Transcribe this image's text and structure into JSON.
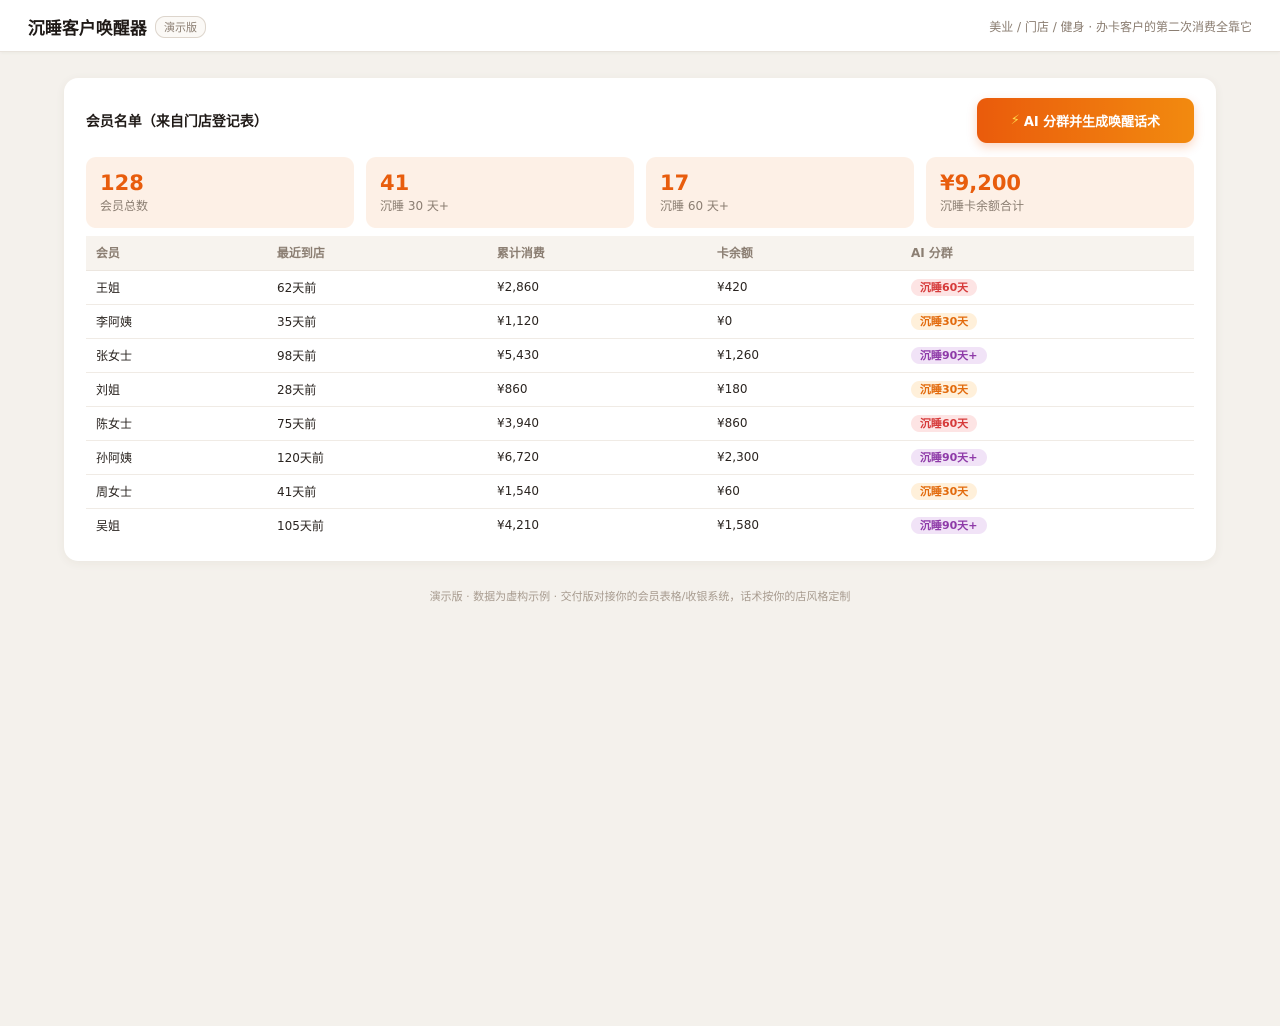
{
  "header": {
    "title": "沉睡客户唤醒器",
    "tag": "演示版",
    "subtitle": "美业 / 门店 / 健身 · 办卡客户的第二次消费全靠它"
  },
  "card": {
    "title": "会员名单（来自门店登记表）",
    "action_icon": "⚡",
    "action_label": "AI 分群并生成唤醒话术"
  },
  "stats": [
    {
      "value": "128",
      "label": "会员总数"
    },
    {
      "value": "41",
      "label": "沉睡 30 天+"
    },
    {
      "value": "17",
      "label": "沉睡 60 天+"
    },
    {
      "value": "¥9,200",
      "label": "沉睡卡余额合计"
    }
  ],
  "table": {
    "columns": [
      "会员",
      "最近到店",
      "累计消费",
      "卡余额",
      "AI 分群"
    ],
    "rows": [
      {
        "name": "王姐",
        "last": "62天前",
        "total": "¥2,860",
        "balance": "¥420",
        "group": "沉睡60天"
      },
      {
        "name": "李阿姨",
        "last": "35天前",
        "total": "¥1,120",
        "balance": "¥0",
        "group": "沉睡30天"
      },
      {
        "name": "张女士",
        "last": "98天前",
        "total": "¥5,430",
        "balance": "¥1,260",
        "group": "沉睡90天+"
      },
      {
        "name": "刘姐",
        "last": "28天前",
        "total": "¥860",
        "balance": "¥180",
        "group": "沉睡30天"
      },
      {
        "name": "陈女士",
        "last": "75天前",
        "total": "¥3,940",
        "balance": "¥860",
        "group": "沉睡60天"
      },
      {
        "name": "孙阿姨",
        "last": "120天前",
        "total": "¥6,720",
        "balance": "¥2,300",
        "group": "沉睡90天+"
      },
      {
        "name": "周女士",
        "last": "41天前",
        "total": "¥1,540",
        "balance": "¥60",
        "group": "沉睡30天"
      },
      {
        "name": "吴姐",
        "last": "105天前",
        "total": "¥4,210",
        "balance": "¥1,580",
        "group": "沉睡90天+"
      }
    ]
  },
  "badge_colors": {
    "沉睡30天": "#e26a0c",
    "沉睡60天": "#d63a3a",
    "沉睡90天+": "#8e3aa8"
  },
  "footer": "演示版 · 数据为虚构示例 · 交付版对接你的会员表格/收银系统，话术按你的店风格定制"
}
